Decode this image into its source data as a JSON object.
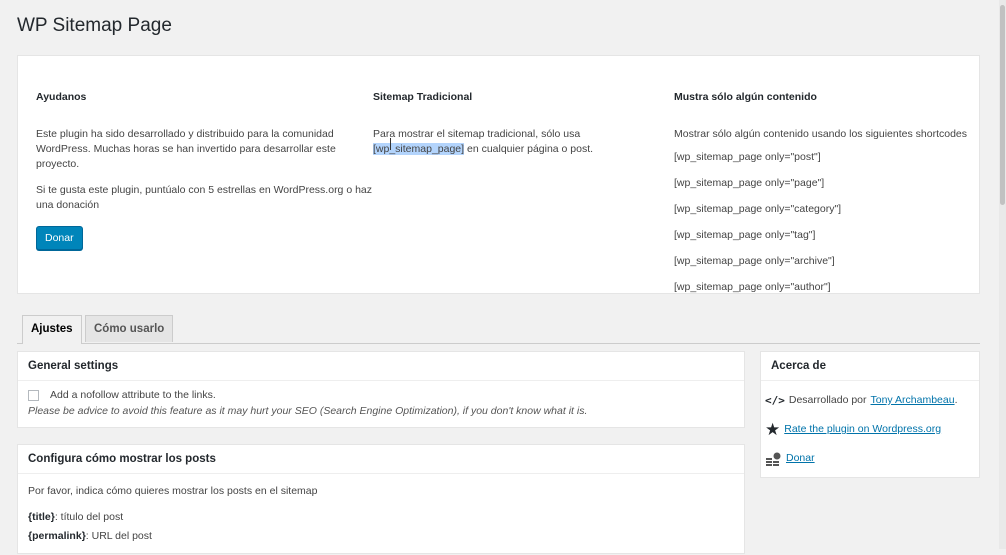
{
  "page": {
    "title": "WP Sitemap Page"
  },
  "help": {
    "ayudanos": {
      "title": "Ayudanos",
      "p1": "Este plugin ha sido desarrollado y distribuido para la comunidad WordPress. Muchas horas se han invertido para desarrollar este proyecto.",
      "p2": "Si te gusta este plugin, puntúalo con 5 estrellas en WordPress.org o haz una donación",
      "donate_label": "Donar"
    },
    "traditional": {
      "title": "Sitemap Tradicional",
      "p1": "Para mostrar el sitemap tradicional, sólo usa",
      "shortcode": "[wp_sitemap_page]",
      "p1_suffix": " en cualquier página o post."
    },
    "only": {
      "title": "Mustra sólo algún contenido",
      "intro": "Mostrar sólo algún contenido usando los siguientes shortcodes",
      "codes": [
        "[wp_sitemap_page only=\"post\"]",
        "[wp_sitemap_page only=\"page\"]",
        "[wp_sitemap_page only=\"category\"]",
        "[wp_sitemap_page only=\"tag\"]",
        "[wp_sitemap_page only=\"archive\"]",
        "[wp_sitemap_page only=\"author\"]"
      ]
    }
  },
  "tabs": [
    {
      "label": "Ajustes",
      "active": true
    },
    {
      "label": "Cómo usarlo",
      "active": false
    }
  ],
  "general_settings": {
    "title": "General settings",
    "checkbox_label": "Add a nofollow attribute to the links.",
    "note": "Please be advice to avoid this feature as it may hurt your SEO (Search Engine Optimization), if you don't know what it is."
  },
  "configure_posts": {
    "title": "Configura cómo mostrar los posts",
    "intro": "Por favor, indica cómo quieres mostrar los posts en el sitemap",
    "vars": [
      {
        "key": "{title}",
        "desc": ": título del post"
      },
      {
        "key": "{permalink}",
        "desc": ": URL del post"
      }
    ]
  },
  "about": {
    "title": "Acerca de",
    "dev_prefix": "Desarrollado por ",
    "dev_name": "Tony Archambeau",
    "dev_suffix": ".",
    "rate_label": "Rate the plugin on Wordpress.org",
    "donate_label": "Donar",
    "icons": [
      "code-icon",
      "star-icon",
      "coins-icon"
    ]
  },
  "colors": {
    "primary_button": "#0085ba",
    "link": "#0073aa",
    "highlight": "#b3d4fc"
  }
}
